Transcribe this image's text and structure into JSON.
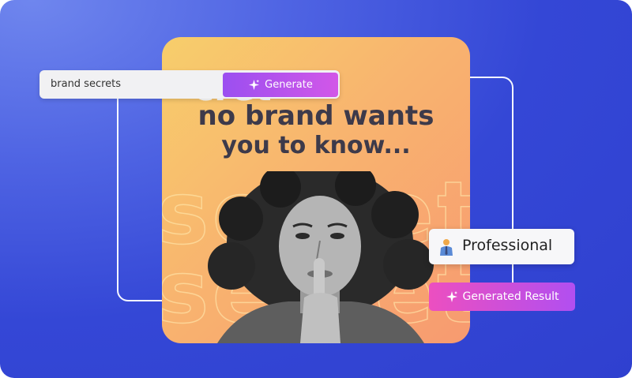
{
  "search": {
    "value": "brand secrets"
  },
  "generate_button": {
    "label": "Generate",
    "icon": "sparkles-icon"
  },
  "card": {
    "headline_line1": "cret",
    "headline_line2": "no brand wants",
    "headline_line3": "you to know...",
    "background_word": "secret"
  },
  "tone_chip": {
    "label": "Professional",
    "icon": "businessperson-icon"
  },
  "result_button": {
    "label": "Generated Result",
    "icon": "sparkles-icon"
  },
  "colors": {
    "background": "#3447d6",
    "card_gradient_start": "#f7ce6b",
    "card_gradient_end": "#f79a70",
    "generate_gradient": "#b14ff0",
    "result_gradient": "#ec4fc0"
  }
}
